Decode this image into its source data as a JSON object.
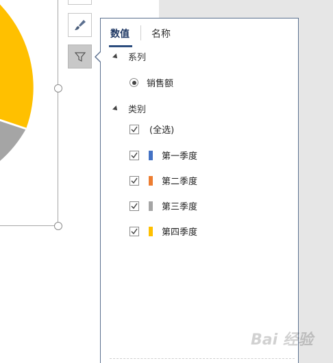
{
  "panel": {
    "tabs": [
      {
        "label": "数值",
        "active": true
      },
      {
        "label": "名称",
        "active": false
      }
    ],
    "series_section": {
      "title": "系列",
      "items": [
        {
          "label": "销售额",
          "selected": true
        }
      ]
    },
    "category_section": {
      "title": "类别",
      "select_all": {
        "label": "(全选)",
        "checked": true
      },
      "items": [
        {
          "label": "第一季度",
          "checked": true,
          "color": "#4472c4"
        },
        {
          "label": "第二季度",
          "checked": true,
          "color": "#ed7d31"
        },
        {
          "label": "第三季度",
          "checked": true,
          "color": "#a5a5a5"
        },
        {
          "label": "第四季度",
          "checked": true,
          "color": "#ffc000"
        }
      ]
    }
  },
  "chart_colors": {
    "yellow": "#ffc000",
    "gray": "#a5a5a5"
  },
  "side_buttons": [
    "chart-elements-icon",
    "brush-icon",
    "filter-icon"
  ],
  "watermark": "Bai 经验"
}
